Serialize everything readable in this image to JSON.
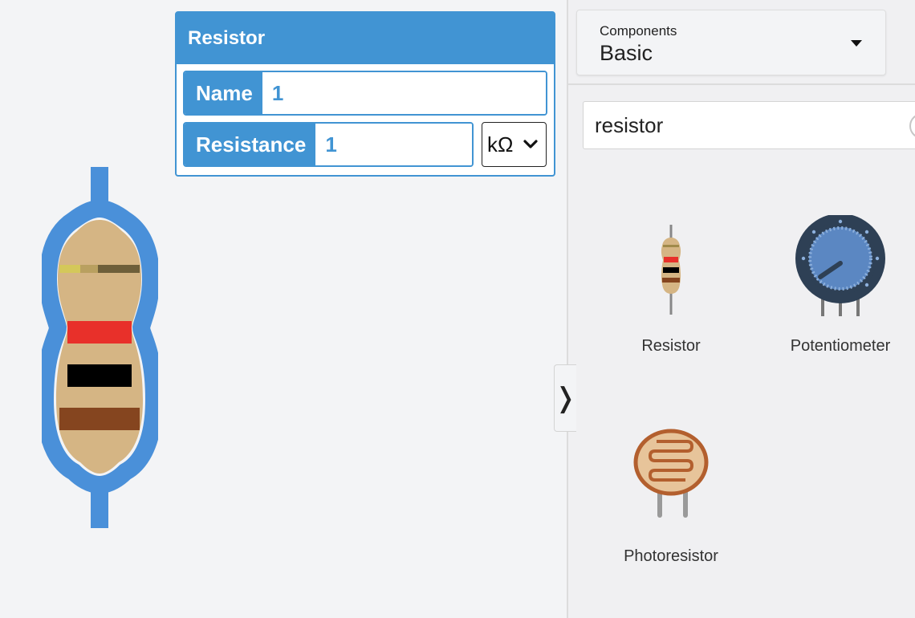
{
  "inspector": {
    "title": "Resistor",
    "name_label": "Name",
    "name_value": "1",
    "resistance_label": "Resistance",
    "resistance_value": "1",
    "unit": "kΩ"
  },
  "panel": {
    "components_caption": "Components",
    "components_value": "Basic",
    "search_value": "resistor",
    "toggle_glyph": "❭",
    "items": [
      {
        "label": "Resistor",
        "icon": "resistor-icon"
      },
      {
        "label": "Potentiometer",
        "icon": "potentiometer-icon"
      },
      {
        "label": "Photoresistor",
        "icon": "photoresistor-icon"
      }
    ]
  },
  "colors": {
    "accent": "#4194d3",
    "resistor_body": "#d5b584",
    "band_red": "#e8302a",
    "band_black": "#000000",
    "band_brown": "#85451f",
    "band_gold": "#c5a74b"
  }
}
